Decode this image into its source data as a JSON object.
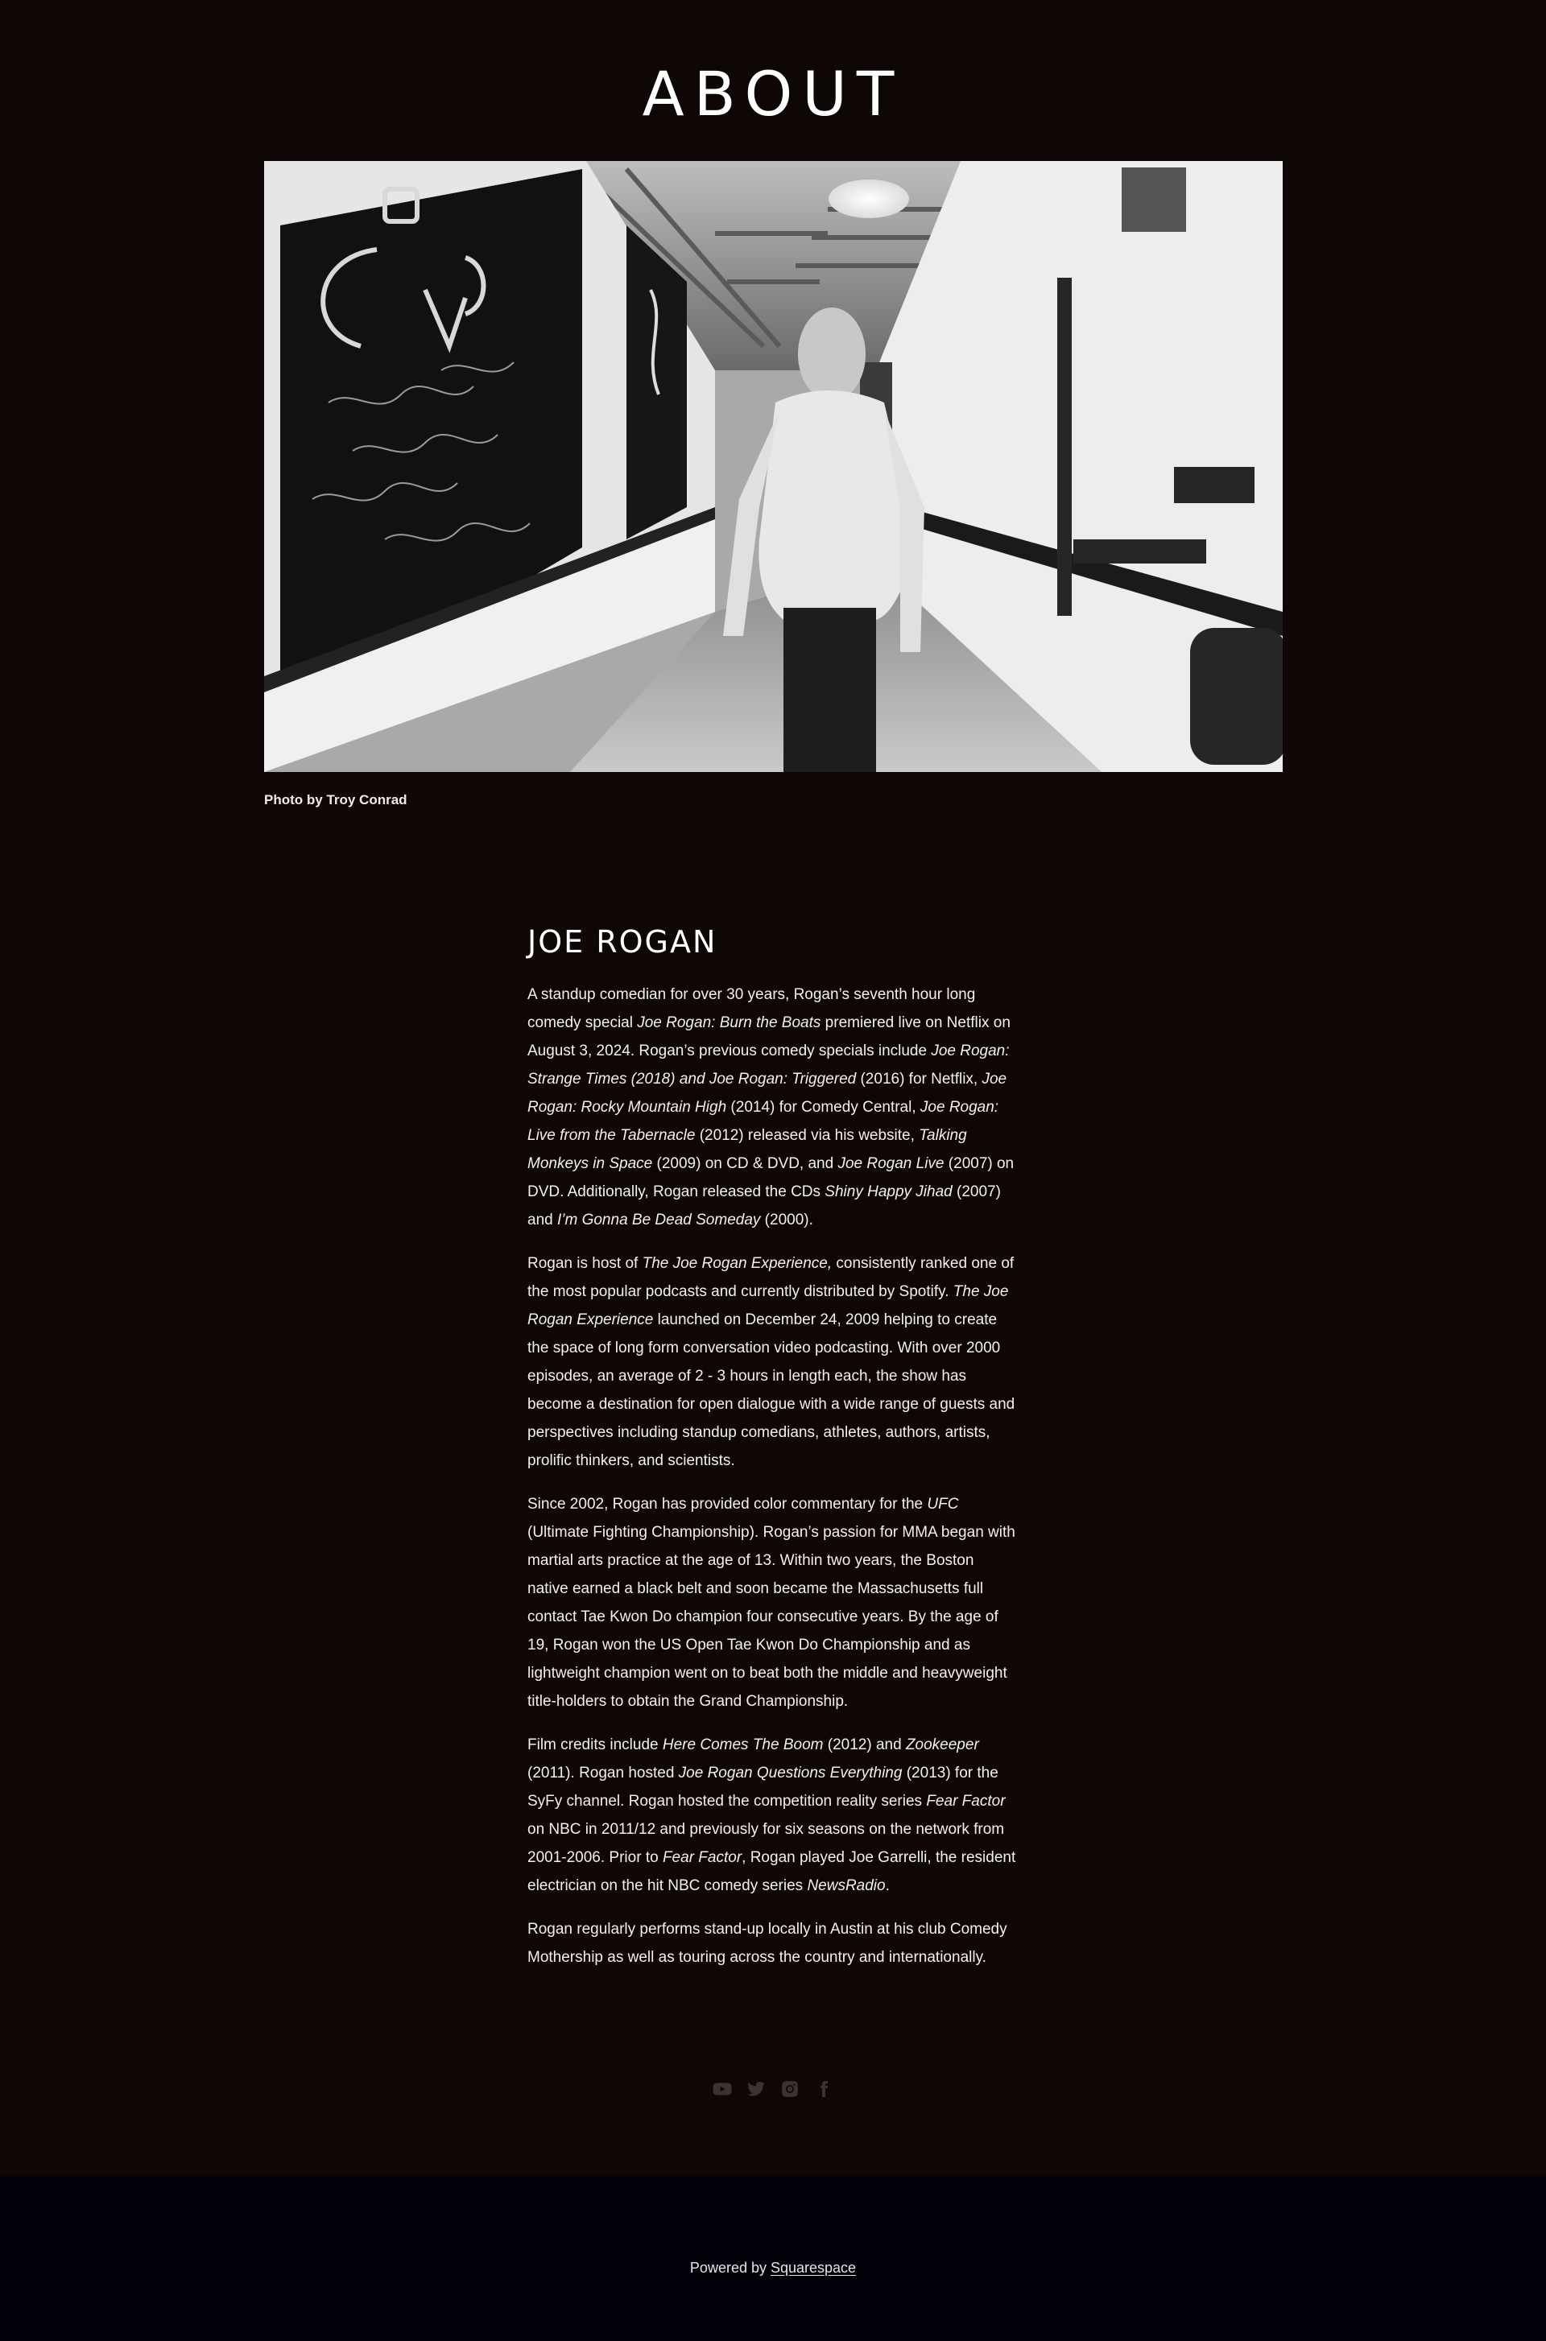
{
  "page": {
    "title": "ABOUT"
  },
  "hero": {
    "caption": "Photo by Troy Conrad"
  },
  "bio": {
    "title": "JOE ROGAN",
    "paragraphs": [
      [
        {
          "t": "A standup comedian for over 30 years, Rogan’s seventh hour long comedy special "
        },
        {
          "t": "Joe Rogan: Burn the Boats",
          "i": true
        },
        {
          "t": " premiered live on Netflix on August 3, 2024. Rogan’s previous comedy specials include "
        },
        {
          "t": "Joe Rogan: Strange Times (2018) and Joe Rogan: Triggered",
          "i": true
        },
        {
          "t": " (2016) for Netflix, "
        },
        {
          "t": "Joe Rogan: Rocky Mountain High",
          "i": true
        },
        {
          "t": " (2014) for Comedy Central, "
        },
        {
          "t": "Joe Rogan: Live from the Tabernacle",
          "i": true
        },
        {
          "t": " (2012) released via his website, "
        },
        {
          "t": "Talking Monkeys in Space",
          "i": true
        },
        {
          "t": " (2009) on CD & DVD, and "
        },
        {
          "t": "Joe Rogan Live",
          "i": true
        },
        {
          "t": " (2007) on DVD. Additionally, Rogan released the CDs "
        },
        {
          "t": "Shiny Happy Jihad",
          "i": true
        },
        {
          "t": " (2007) and "
        },
        {
          "t": "I’m Gonna Be Dead Someday",
          "i": true
        },
        {
          "t": " (2000)."
        }
      ],
      [
        {
          "t": "Rogan is host of "
        },
        {
          "t": "The Joe Rogan Experience,",
          "i": true
        },
        {
          "t": " consistently ranked one of the most popular podcasts and currently distributed by Spotify. "
        },
        {
          "t": "The Joe Rogan Experience",
          "i": true
        },
        {
          "t": " launched on December 24, 2009 helping to create the space of long form conversation video podcasting. With over 2000 episodes, an average of 2  - 3 hours in length each, the show has become a destination for open dialogue with a wide range of guests and perspectives including standup comedians, athletes, authors, artists, prolific thinkers, and scientists."
        }
      ],
      [
        {
          "t": "Since 2002, Rogan has provided color commentary for the "
        },
        {
          "t": "UFC",
          "i": true
        },
        {
          "t": " (Ultimate Fighting Championship).  Rogan’s passion for MMA began with martial arts practice at the age of 13. Within two years, the Boston native earned a black belt and soon became the Massachusetts full contact Tae Kwon Do champion four consecutive years.  By the age of 19, Rogan won the US Open Tae Kwon Do Championship and as lightweight champion went on to beat both the middle and heavyweight title-holders to obtain the Grand Championship."
        }
      ],
      [
        {
          "t": "Film credits include "
        },
        {
          "t": "Here Comes The Boom",
          "i": true
        },
        {
          "t": " (2012) and "
        },
        {
          "t": "Zookeeper",
          "i": true
        },
        {
          "t": " (2011).  Rogan  hosted "
        },
        {
          "t": "Joe Rogan Questions Everything",
          "i": true
        },
        {
          "t": " (2013) for the SyFy channel.  Rogan hosted the competition reality series "
        },
        {
          "t": "Fear Factor",
          "i": true
        },
        {
          "t": " on NBC in 2011/12 and previously for six seasons on the network from 2001-2006.  Prior to "
        },
        {
          "t": "Fear Factor",
          "i": true
        },
        {
          "t": ", Rogan played Joe Garrelli, the resident electrician on the hit NBC comedy series "
        },
        {
          "t": "NewsRadio",
          "i": true
        },
        {
          "t": "."
        }
      ],
      [
        {
          "t": "Rogan regularly performs stand-up locally in Austin at his club Comedy Mothership as well as touring across the country and internationally."
        }
      ]
    ]
  },
  "social": {
    "icons": [
      "youtube-icon",
      "twitter-icon",
      "instagram-icon",
      "facebook-icon"
    ],
    "icon_color": "#3c3331"
  },
  "footer": {
    "powered_prefix": "Powered by ",
    "powered_link": "Squarespace",
    "background": "#03020b"
  },
  "colors": {
    "background": "#0f0706",
    "text": "#f2eeea"
  }
}
